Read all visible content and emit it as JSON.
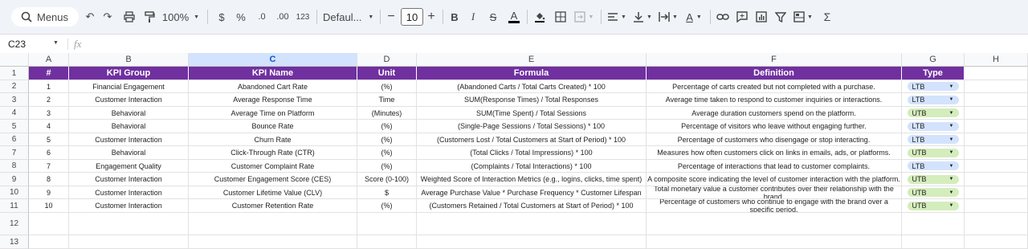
{
  "toolbar": {
    "menus_label": "Menus",
    "zoom": "100%",
    "currency": "$",
    "percent": "%",
    "dec_decrease": ".0",
    "dec_increase": ".00",
    "number_format": "123",
    "font_name": "Defaul...",
    "font_size": "10"
  },
  "formula_bar": {
    "cell_ref": "C23",
    "fx": "fx",
    "content": ""
  },
  "columns": [
    "A",
    "B",
    "C",
    "D",
    "E",
    "F",
    "G",
    "H"
  ],
  "selected_column": "C",
  "row_numbers": [
    "1",
    "2",
    "3",
    "4",
    "5",
    "6",
    "7",
    "8",
    "9",
    "10",
    "11",
    "12",
    "13"
  ],
  "headers": [
    "#",
    "KPI Group",
    "KPI Name",
    "Unit",
    "Formula",
    "Definition",
    "Type"
  ],
  "rows": [
    {
      "num": "1",
      "group": "Financial Engagement",
      "name": "Abandoned Cart Rate",
      "unit": "(%)",
      "formula": "(Abandoned Carts / Total Carts Created) * 100",
      "definition": "Percentage of carts created but not completed with a purchase.",
      "type": "LTB"
    },
    {
      "num": "2",
      "group": "Customer Interaction",
      "name": "Average Response Time",
      "unit": "Time",
      "formula": "SUM(Response Times) / Total Responses",
      "definition": "Average time taken to respond to customer inquiries or interactions.",
      "type": "LTB"
    },
    {
      "num": "3",
      "group": "Behavioral",
      "name": "Average Time on Platform",
      "unit": "(Minutes)",
      "formula": "SUM(Time Spent) / Total Sessions",
      "definition": "Average duration customers spend on the platform.",
      "type": "UTB"
    },
    {
      "num": "4",
      "group": "Behavioral",
      "name": "Bounce Rate",
      "unit": "(%)",
      "formula": "(Single-Page Sessions / Total Sessions) * 100",
      "definition": "Percentage of visitors who leave without engaging further.",
      "type": "LTB"
    },
    {
      "num": "5",
      "group": "Customer Interaction",
      "name": "Churn Rate",
      "unit": "(%)",
      "formula": "(Customers Lost / Total Customers at Start of Period) * 100",
      "definition": "Percentage of customers who disengage or stop interacting.",
      "type": "LTB"
    },
    {
      "num": "6",
      "group": "Behavioral",
      "name": "Click-Through Rate (CTR)",
      "unit": "(%)",
      "formula": "(Total Clicks / Total Impressions) * 100",
      "definition": "Measures how often customers click on links in emails, ads, or platforms.",
      "type": "UTB"
    },
    {
      "num": "7",
      "group": "Engagement Quality",
      "name": "Customer Complaint Rate",
      "unit": "(%)",
      "formula": "(Complaints / Total Interactions) * 100",
      "definition": "Percentage of interactions that lead to customer complaints.",
      "type": "LTB"
    },
    {
      "num": "8",
      "group": "Customer Interaction",
      "name": "Customer Engagement Score (CES)",
      "unit": "Score (0-100)",
      "formula": "Weighted Score of Interaction Metrics (e.g., logins, clicks, time spent)",
      "definition": "A composite score indicating the level of customer interaction with the platform.",
      "type": "UTB"
    },
    {
      "num": "9",
      "group": "Customer Interaction",
      "name": "Customer Lifetime Value (CLV)",
      "unit": "$",
      "formula": "Average Purchase Value * Purchase Frequency * Customer Lifespan",
      "definition": "Total monetary value a customer contributes over their relationship with the brand.",
      "type": "UTB"
    },
    {
      "num": "10",
      "group": "Customer Interaction",
      "name": "Customer Retention Rate",
      "unit": "(%)",
      "formula": "(Customers Retained / Total Customers at Start of Period) * 100",
      "definition": "Percentage of customers who continue to engage with the brand over a specific period.",
      "type": "UTB"
    }
  ],
  "chip_colors": {
    "LTB": "#d3e3fd",
    "UTB": "#d4edbc"
  },
  "header_color": "#7030a0"
}
